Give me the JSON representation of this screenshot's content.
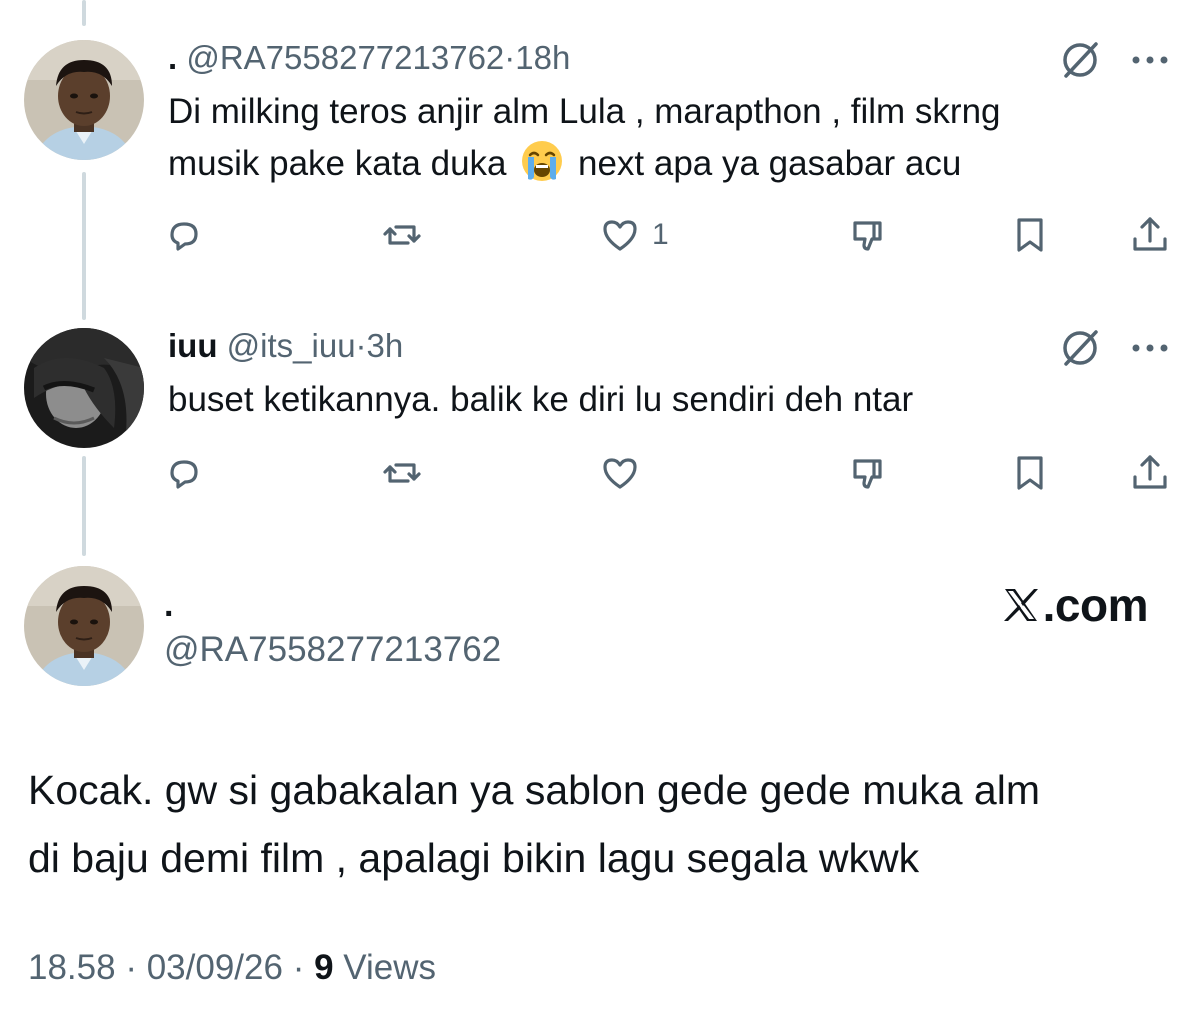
{
  "reply1": {
    "name": ".",
    "handle": "@RA7558277213762",
    "separator": "·",
    "time": "18h",
    "text_line1": "Di milking teros anjir alm Lula , marapthon , film skrng",
    "text_line2_before": "musik pake kata duka",
    "emoji": "loudly-crying-face",
    "text_line2_after": "next apa ya gasabar acu",
    "like_count": "1"
  },
  "reply2": {
    "name": "iuu",
    "handle": "@its_iuu",
    "separator": "·",
    "time": "3h",
    "text": "buset ketikannya. balik ke diri lu sendiri deh ntar"
  },
  "main_post": {
    "name": ".",
    "handle": "@RA7558277213762",
    "brand": ".com",
    "text_line1": "Kocak. gw si gabakalan ya sablon gede gede muka alm",
    "text_line2": "di baju demi film , apalagi bikin lagu segala wkwk",
    "time": "18.58",
    "separator": "·",
    "date": "03/09/26",
    "views_count": "9",
    "views_label": "Views"
  },
  "icons": {
    "reply": "reply-bubble-icon",
    "repost": "repost-icon",
    "like": "heart-icon",
    "dislike": "thumbs-down-icon",
    "bookmark": "bookmark-icon",
    "share": "share-upload-icon",
    "grok": "grok-slash-icon",
    "more": "more-dots-icon",
    "brand": "x-logo-icon"
  },
  "colors": {
    "text": "#0f1419",
    "muted": "#536471",
    "thread_line": "#cfd9de"
  }
}
